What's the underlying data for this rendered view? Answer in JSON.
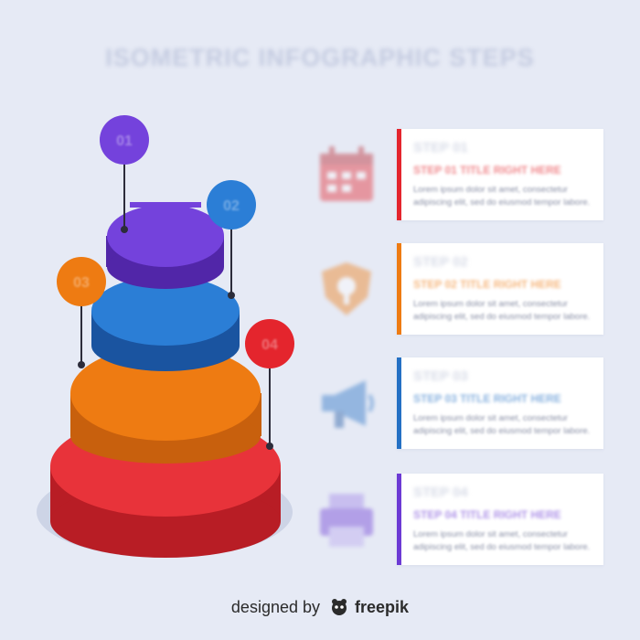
{
  "title": "ISOMETRIC INFOGRAPHIC STEPS",
  "colors": {
    "step1": "#e4252d",
    "step2": "#ee7b12",
    "step3": "#2470c4",
    "step4": "#6c3ad4",
    "background": "#e6eaf5"
  },
  "pyramid_labels": [
    "04",
    "03",
    "02",
    "01"
  ],
  "steps": [
    {
      "number": "STEP 01",
      "title": "STEP 01 TITLE RIGHT HERE",
      "text": "Lorem ipsum dolor sit amet, consectetur adipiscing elit, sed do eiusmod tempor labore.",
      "icon": "calendar-icon"
    },
    {
      "number": "STEP 02",
      "title": "STEP 02 TITLE RIGHT HERE",
      "text": "Lorem ipsum dolor sit amet, consectetur adipiscing elit, sed do eiusmod tempor labore.",
      "icon": "shield-icon"
    },
    {
      "number": "STEP 03",
      "title": "STEP 03 TITLE RIGHT HERE",
      "text": "Lorem ipsum dolor sit amet, consectetur adipiscing elit, sed do eiusmod tempor labore.",
      "icon": "megaphone-icon"
    },
    {
      "number": "STEP 04",
      "title": "STEP 04 TITLE RIGHT HERE",
      "text": "Lorem ipsum dolor sit amet, consectetur adipiscing elit, sed do eiusmod tempor labore.",
      "icon": "printer-icon"
    }
  ],
  "footer": {
    "prefix": "designed by",
    "brand": "freepik"
  }
}
